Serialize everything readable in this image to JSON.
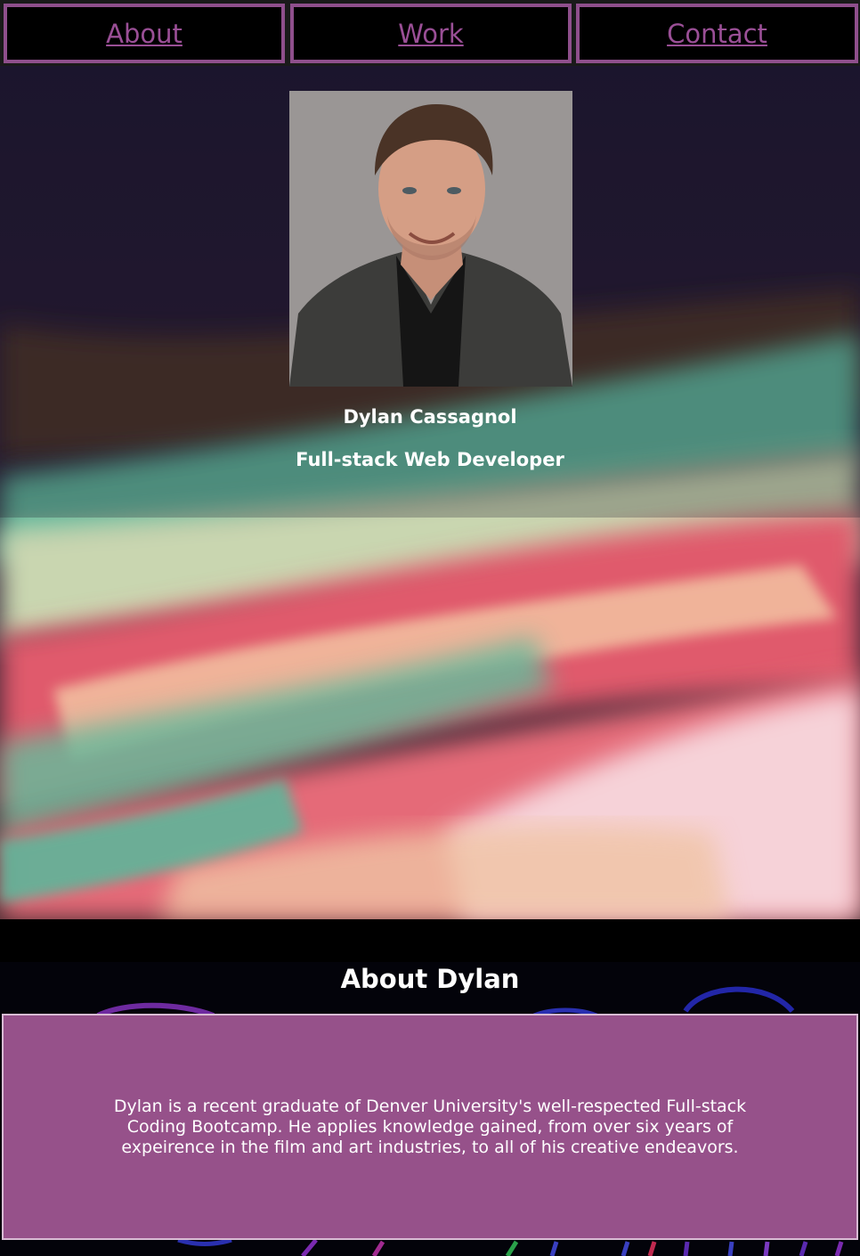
{
  "nav": {
    "items": [
      {
        "label": "About"
      },
      {
        "label": "Work"
      },
      {
        "label": "Contact"
      }
    ]
  },
  "hero": {
    "name": "Dylan Cassagnol",
    "title": "Full-stack Web Developer",
    "portrait_alt": "Portrait of Dylan Cassagnol"
  },
  "about": {
    "heading": "About Dylan",
    "body": "Dylan is a recent graduate of Denver University's well-respected Full-stack Coding Bootcamp. He applies knowledge gained, from over six years of expeirence in the film and art industries, to all of his creative endeavors."
  },
  "colors": {
    "nav_border": "#8f4f8c",
    "nav_link": "#9a4f96",
    "about_card": "#96518a",
    "hero_teal": "#5fb59a",
    "hero_pink": "#e05a6c",
    "hero_peach": "#f5c7a6"
  }
}
